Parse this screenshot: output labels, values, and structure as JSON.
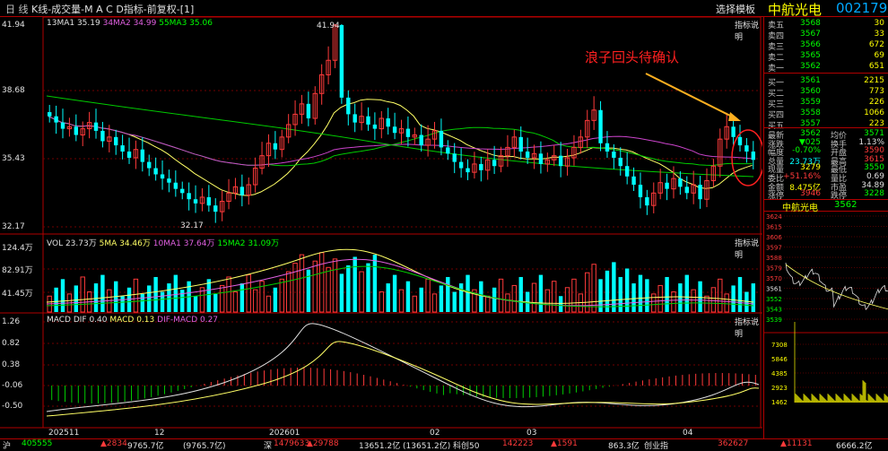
{
  "title_bar": {
    "mode": "日 线",
    "title": "K线-成交量-M A C D指标-前复权-[1]",
    "template": "选择模板",
    "stock_name": "中航光电",
    "stock_code": "002179"
  },
  "kline": {
    "ma_legend": [
      "13MA1 35.19",
      "34MA2 34.99",
      "55MA3 35.06"
    ],
    "indicator_btn": "指标说明",
    "y_labels": [
      "41.94",
      "38.68",
      "35.43",
      "32.17"
    ],
    "high_label": "41.94",
    "low_label": "32.17",
    "annotation": "浪子回头待确认",
    "colors": {
      "up": "#ff3a3a",
      "down": "#00ffff",
      "ma13": "#ffff66",
      "ma34": "#00cc00",
      "ma55": "#cc44cc",
      "annotation": "#ff2020",
      "arrow": "#ffb020"
    }
  },
  "volume": {
    "legend": [
      "VOL 23.73万",
      "5MA 34.46万",
      "10MA1 37.64万",
      "15MA2 31.09万"
    ],
    "indicator_btn": "指标说明",
    "y_labels": [
      "124.4万",
      "82.91万",
      "41.45万"
    ]
  },
  "macd": {
    "legend": [
      "MACD DIF 0.40",
      "MACD 0.13",
      "DIF-MACD 0.27"
    ],
    "indicator_btn": "指标说明",
    "y_labels": [
      "1.26",
      "0.82",
      "0.38",
      "-0.06",
      "-0.50"
    ]
  },
  "x_labels": [
    "202511",
    "12",
    "202601",
    "02",
    "03",
    "04"
  ],
  "order_book": {
    "sells": [
      {
        "label": "卖五",
        "price": "3568",
        "vol": "30"
      },
      {
        "label": "卖四",
        "price": "3567",
        "vol": "33"
      },
      {
        "label": "卖三",
        "price": "3566",
        "vol": "672"
      },
      {
        "label": "卖二",
        "price": "3565",
        "vol": "69"
      },
      {
        "label": "卖一",
        "price": "3562",
        "vol": "651"
      }
    ],
    "buys": [
      {
        "label": "买一",
        "price": "3561",
        "vol": "2215"
      },
      {
        "label": "买二",
        "price": "3560",
        "vol": "773"
      },
      {
        "label": "买三",
        "price": "3559",
        "vol": "226"
      },
      {
        "label": "买四",
        "price": "3558",
        "vol": "1066"
      },
      {
        "label": "买五",
        "price": "3557",
        "vol": "223"
      }
    ]
  },
  "quote": [
    {
      "l1": "最新",
      "v1": "3562",
      "l2": "均价",
      "v2": "3571"
    },
    {
      "l1": "涨跌",
      "v1": "▼025",
      "l2": "换手",
      "v2": "1.13%"
    },
    {
      "l1": "幅度",
      "v1": "-0.70%",
      "l2": "开盘",
      "v2": "3590"
    },
    {
      "l1": "总量",
      "v1": "23.73万",
      "l2": "最高",
      "v2": "3615"
    },
    {
      "l1": "现量",
      "v1": "3279",
      "l2": "最低",
      "v2": "3550"
    },
    {
      "l1": "委比",
      "v1": "+51.16%",
      "l2": "量比",
      "v2": "0.69"
    },
    {
      "l1": "金额",
      "v1": "8.475亿",
      "l2": "市盈",
      "v2": "34.89"
    },
    {
      "l1": "涨停",
      "v1": "3946",
      "l2": "跌停",
      "v2": "3228"
    }
  ],
  "mini": {
    "name": "中航光电",
    "price": "3562",
    "price_labels": [
      "3624",
      "3615",
      "3606",
      "3597",
      "3588",
      "3579",
      "3570",
      "3561",
      "3552",
      "3543",
      "3539"
    ],
    "vol_labels": [
      "7308",
      "5846",
      "4385",
      "2923",
      "1462"
    ]
  },
  "status_bar": {
    "items": [
      {
        "t": "沪",
        "c": "#e0e0e0"
      },
      {
        "t": "405555",
        "c": "#00ff00"
      },
      {
        "t": "▲2834",
        "c": "#ff3a3a"
      },
      {
        "t": "9765.7亿",
        "c": "#e0e0e0"
      },
      {
        "t": "(9765.7亿)",
        "c": "#e0e0e0"
      },
      {
        "t": "深",
        "c": "#e0e0e0"
      },
      {
        "t": "1479633",
        "c": "#ff3a3a"
      },
      {
        "t": "▲29788",
        "c": "#ff3a3a"
      },
      {
        "t": "13651.2亿",
        "c": "#e0e0e0"
      },
      {
        "t": "(13651.2亿)",
        "c": "#e0e0e0"
      },
      {
        "t": "科创50",
        "c": "#e0e0e0"
      },
      {
        "t": "142223",
        "c": "#ff3a3a"
      },
      {
        "t": "▲1591",
        "c": "#ff3a3a"
      },
      {
        "t": "863.3亿",
        "c": "#e0e0e0"
      },
      {
        "t": "创业指",
        "c": "#e0e0e0"
      },
      {
        "t": "362627",
        "c": "#ff3a3a"
      },
      {
        "t": "▲11131",
        "c": "#ff3a3a"
      },
      {
        "t": "6666.2亿",
        "c": "#e0e0e0"
      }
    ]
  }
}
